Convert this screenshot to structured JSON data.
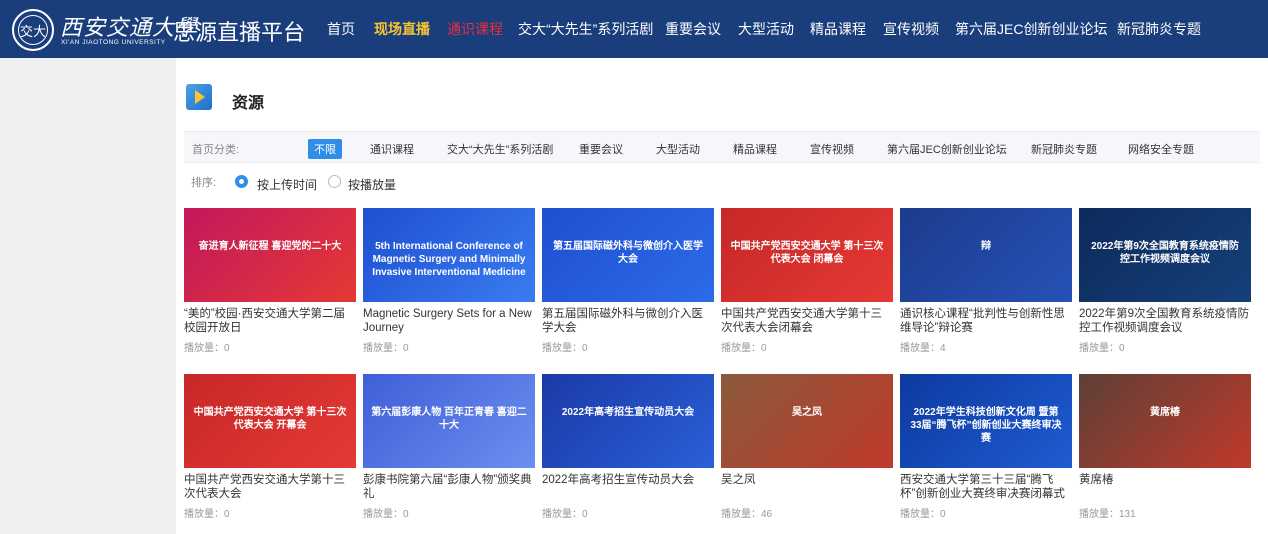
{
  "header": {
    "logo_seal": "交大",
    "logo_cn": "西安交通大學",
    "logo_en": "XI'AN JIAOTONG UNIVERSITY",
    "site_title": "思源直播平台",
    "bg_color": "#1a3d7c",
    "nav": [
      {
        "label": "首页",
        "state": "normal"
      },
      {
        "label": "现场直播",
        "state": "active"
      },
      {
        "label": "通识课程",
        "state": "hot"
      },
      {
        "label": "交大“大先生”系列活剧",
        "state": "normal"
      },
      {
        "label": "重要会议",
        "state": "normal"
      },
      {
        "label": "大型活动",
        "state": "normal"
      },
      {
        "label": "精品课程",
        "state": "normal"
      },
      {
        "label": "宣传视频",
        "state": "normal"
      },
      {
        "label": "第六届JEC创新创业论坛",
        "state": "normal"
      },
      {
        "label": "新冠肺炎专题",
        "state": "normal"
      }
    ]
  },
  "resources": {
    "title": "资源",
    "icon": "video-play-icon",
    "filter": {
      "label": "首页分类:",
      "categories": [
        "不限",
        "通识课程",
        "交大“大先生”系列活剧",
        "重要会议",
        "大型活动",
        "精品课程",
        "宣传视频",
        "第六届JEC创新创业论坛",
        "新冠肺炎专题",
        "网络安全专题"
      ],
      "selected": "不限"
    },
    "sort": {
      "label": "排序:",
      "options": [
        "按上传时间",
        "按播放量"
      ],
      "selected": "按上传时间"
    }
  },
  "videos": [
    {
      "title": "“美的”校园·西安交通大学第二届校园开放日",
      "views": "播放量：0",
      "thumb_text": "奋进育人新征程 喜迎党的二十大",
      "thumb_bg": "linear-gradient(135deg,#c2185b,#e53935)"
    },
    {
      "title": "Magnetic Surgery Sets for a New Journey",
      "views": "播放量：0",
      "thumb_text": "5th International Conference of Magnetic Surgery and Minimally Invasive Interventional Medicine",
      "thumb_bg": "linear-gradient(135deg,#1e4fd1,#3a7cf0)"
    },
    {
      "title": "第五届国际磁外科与微创介入医学大会",
      "views": "播放量：0",
      "thumb_text": "第五届国际磁外科与微创介入医学大会",
      "thumb_bg": "linear-gradient(135deg,#1e4fd1,#2d6be8)"
    },
    {
      "title": "中国共产党西安交通大学第十三次代表大会闭幕会",
      "views": "播放量：0",
      "thumb_text": "中国共产党西安交通大学 第十三次代表大会 闭幕会",
      "thumb_bg": "linear-gradient(135deg,#c62828,#e53935)"
    },
    {
      "title": "通识核心课程“批判性与创新性思维导论”辩论赛",
      "views": "播放量：4",
      "thumb_text": "辩",
      "thumb_bg": "linear-gradient(135deg,#1b3c8c,#2751b8)"
    },
    {
      "title": "2022年第9次全国教育系统疫情防控工作视频调度会议",
      "views": "播放量：0",
      "thumb_text": "2022年第9次全国教育系统疫情防控工作视频调度会议",
      "thumb_bg": "linear-gradient(135deg,#0d2a5c,#15407a)"
    },
    {
      "title": "中国共产党西安交通大学第十三次代表大会",
      "views": "播放量：0",
      "thumb_text": "中国共产党西安交通大学 第十三次代表大会 开幕会",
      "thumb_bg": "linear-gradient(135deg,#c62828,#e53935)"
    },
    {
      "title": "彭康书院第六届“彭康人物”颁奖典礼",
      "views": "播放量：0",
      "thumb_text": "第六届彭康人物 百年正青春 喜迎二十大",
      "thumb_bg": "linear-gradient(135deg,#3f5fd6,#6d8ef0)"
    },
    {
      "title": "2022年高考招生宣传动员大会",
      "views": "播放量：0",
      "thumb_text": "2022年高考招生宣传动员大会",
      "thumb_bg": "linear-gradient(135deg,#1a3aa6,#2b5fd8)"
    },
    {
      "title": "吴之凤",
      "views": "播放量：46",
      "thumb_text": "吴之凤",
      "thumb_bg": "linear-gradient(135deg,#8a5a3c,#c0392b)"
    },
    {
      "title": "西安交通大学第三十三届“腾飞杯”创新创业大赛终审决赛闭幕式",
      "views": "播放量：0",
      "thumb_text": "2022年学生科技创新文化周 暨第33届“腾飞杯”创新创业大赛终审决赛",
      "thumb_bg": "linear-gradient(135deg,#0d3aa0,#1f5bd0)"
    },
    {
      "title": "黄席椿",
      "views": "播放量：131",
      "thumb_text": "黄席椿",
      "thumb_bg": "linear-gradient(135deg,#5d4037,#c0392b)"
    }
  ]
}
